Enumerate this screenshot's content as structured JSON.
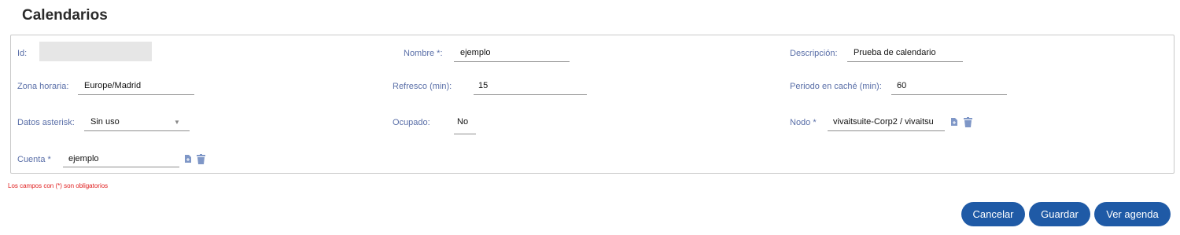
{
  "page": {
    "title": "Calendarios"
  },
  "form": {
    "id": {
      "label": "Id:",
      "value": ""
    },
    "nombre": {
      "label": "Nombre *:",
      "value": "ejemplo"
    },
    "descripcion": {
      "label": "Descripción:",
      "value": "Prueba de calendario"
    },
    "zona_horaria": {
      "label": "Zona horaria:",
      "value": "Europe/Madrid"
    },
    "refresco": {
      "label": "Refresco (min):",
      "value": "15"
    },
    "periodo_cache": {
      "label": "Periodo en caché (min):",
      "value": "60"
    },
    "datos_asterisk": {
      "label": "Datos asterisk:",
      "value": "Sin uso"
    },
    "ocupado": {
      "label": "Ocupado:",
      "value": "No"
    },
    "nodo": {
      "label": "Nodo *",
      "value": "vivaitsuite-Corp2 / vivaitsu"
    },
    "cuenta": {
      "label": "Cuenta *",
      "value": "ejemplo"
    }
  },
  "required_note": "Los campos con (*) son obligatorios",
  "buttons": {
    "cancel": "Cancelar",
    "save": "Guardar",
    "agenda": "Ver agenda"
  },
  "colors": {
    "label": "#5a6fa8",
    "button": "#1f5aa6",
    "icon": "#7f97c7",
    "note": "#e02020"
  },
  "icons": {
    "file": "file-icon",
    "trash": "trash-icon",
    "dropdown": "chevron-down-icon"
  }
}
